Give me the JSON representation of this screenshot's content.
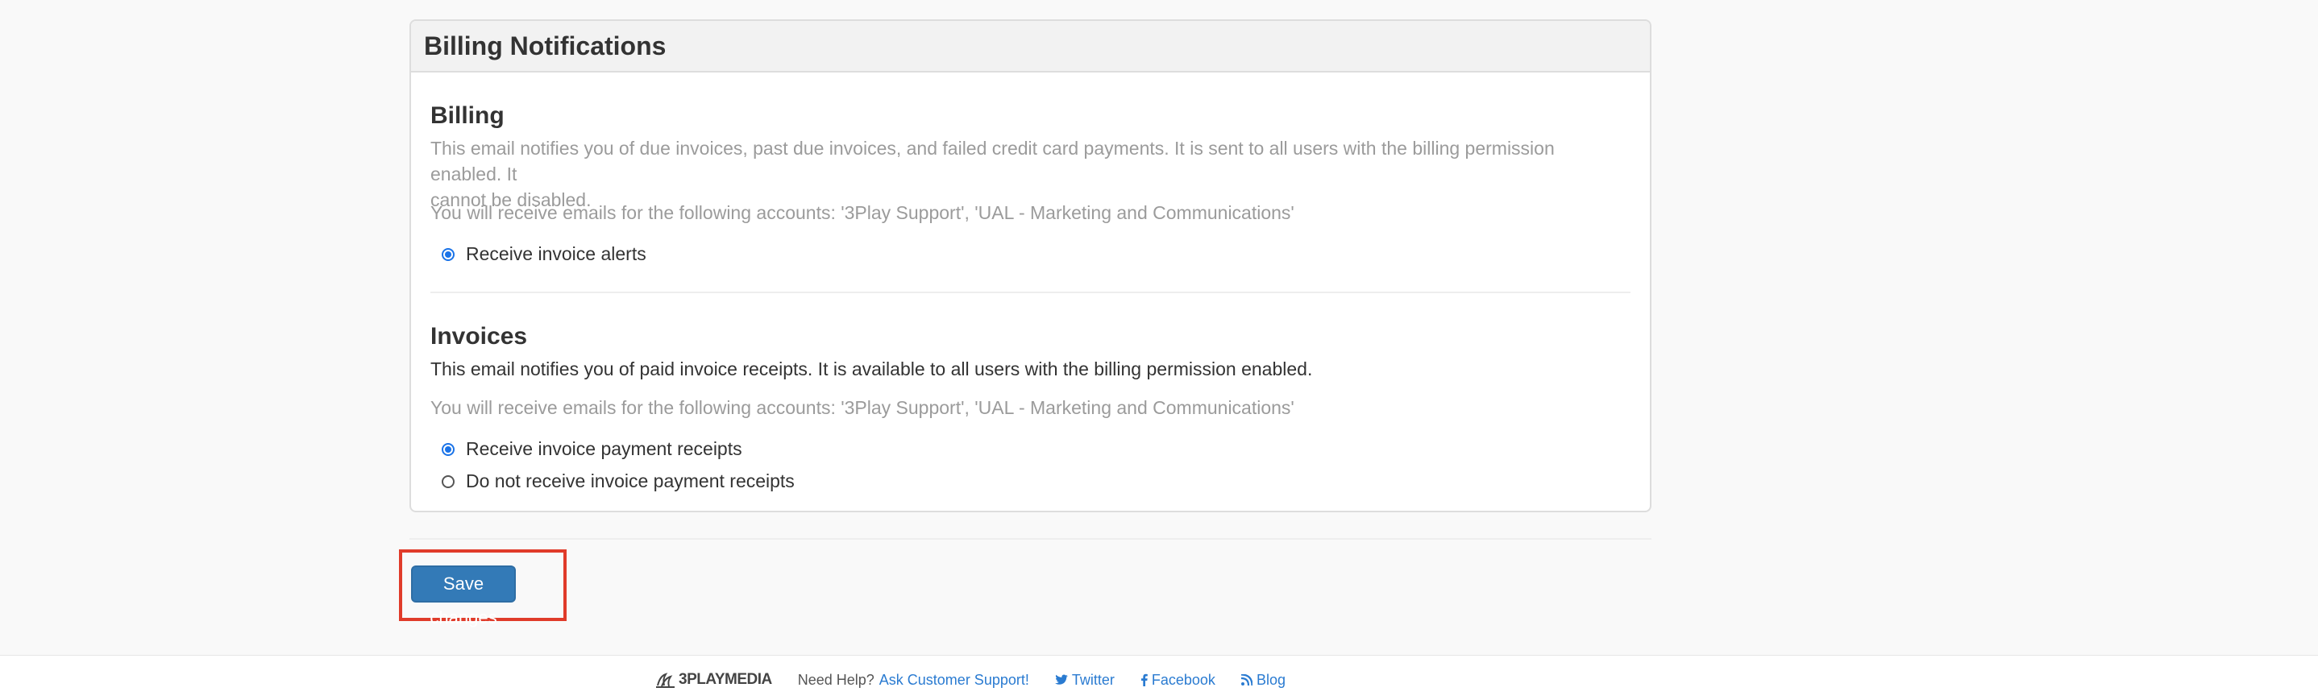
{
  "panel": {
    "title": "Billing Notifications",
    "billing": {
      "title": "Billing",
      "description_line1": "This email notifies you of due invoices, past due invoices, and failed credit card payments. It is sent to all users with the billing permission enabled. It",
      "description_line2": "cannot be disabled.",
      "accounts_text": "You will receive emails for the following accounts: '3Play Support', 'UAL - Marketing and Communications'",
      "options": [
        {
          "label": "Receive invoice alerts",
          "checked": true
        }
      ]
    },
    "invoices": {
      "title": "Invoices",
      "description": "This email notifies you of paid invoice receipts. It is available to all users with the billing permission enabled.",
      "accounts_text": "You will receive emails for the following accounts: '3Play Support', 'UAL - Marketing and Communications'",
      "options": [
        {
          "label": "Receive invoice payment receipts",
          "checked": true
        },
        {
          "label": "Do not receive invoice payment receipts",
          "checked": false
        }
      ]
    }
  },
  "save_button": {
    "label": "Save changes"
  },
  "footer": {
    "logo_text": "3PLAYMEDIA",
    "need_help": "Need Help?",
    "support_link": "Ask Customer Support!",
    "twitter": "Twitter",
    "facebook": "Facebook",
    "blog": "Blog"
  },
  "colors": {
    "primary_button": "#337ab7",
    "link": "#2a7bd1",
    "radio_selected": "#1a73e8",
    "highlight": "#e03b2a"
  }
}
